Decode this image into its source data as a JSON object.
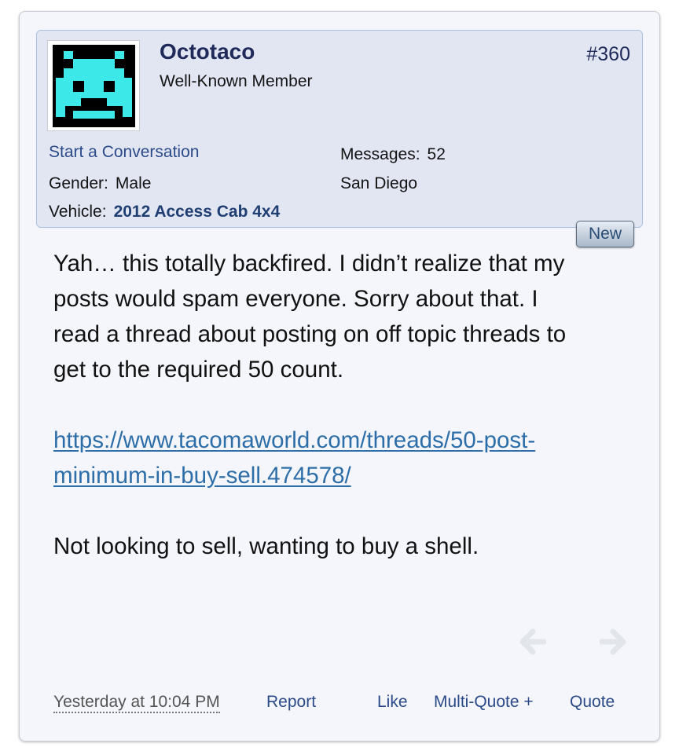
{
  "post": {
    "number": "#360",
    "new_badge": "New",
    "body": {
      "paragraph1": "Yah… this totally backfired. I didn’t realize that my posts would spam everyone. Sorry about that. I read a thread about posting on off topic threads to get to the required 50 count.",
      "link_text": "https://www.tacomaworld.com/threads/50-post-minimum-in-buy-sell.474578/",
      "paragraph3": "Not looking to sell, wanting to buy a shell."
    },
    "footer": {
      "date": "Yesterday at 10:04 PM",
      "report": "Report",
      "like": "Like",
      "multiquote": "Multi-Quote +",
      "quote": "Quote"
    }
  },
  "user": {
    "name": "Octotaco",
    "title": "Well-Known Member",
    "start_conversation": "Start a Conversation",
    "gender_label": "Gender:",
    "gender": "Male",
    "vehicle_label": "Vehicle:",
    "vehicle": "2012 Access Cab 4x4",
    "messages_label": "Messages:",
    "messages": "52",
    "location": "San Diego",
    "avatar_icon": "space-invader-icon"
  },
  "icons": {
    "prev": "arrow-left-icon",
    "next": "arrow-right-icon"
  },
  "colors": {
    "username": "#1f2a5a",
    "link": "#2d6ea8",
    "avatar_alien": "#3ce8e8"
  }
}
